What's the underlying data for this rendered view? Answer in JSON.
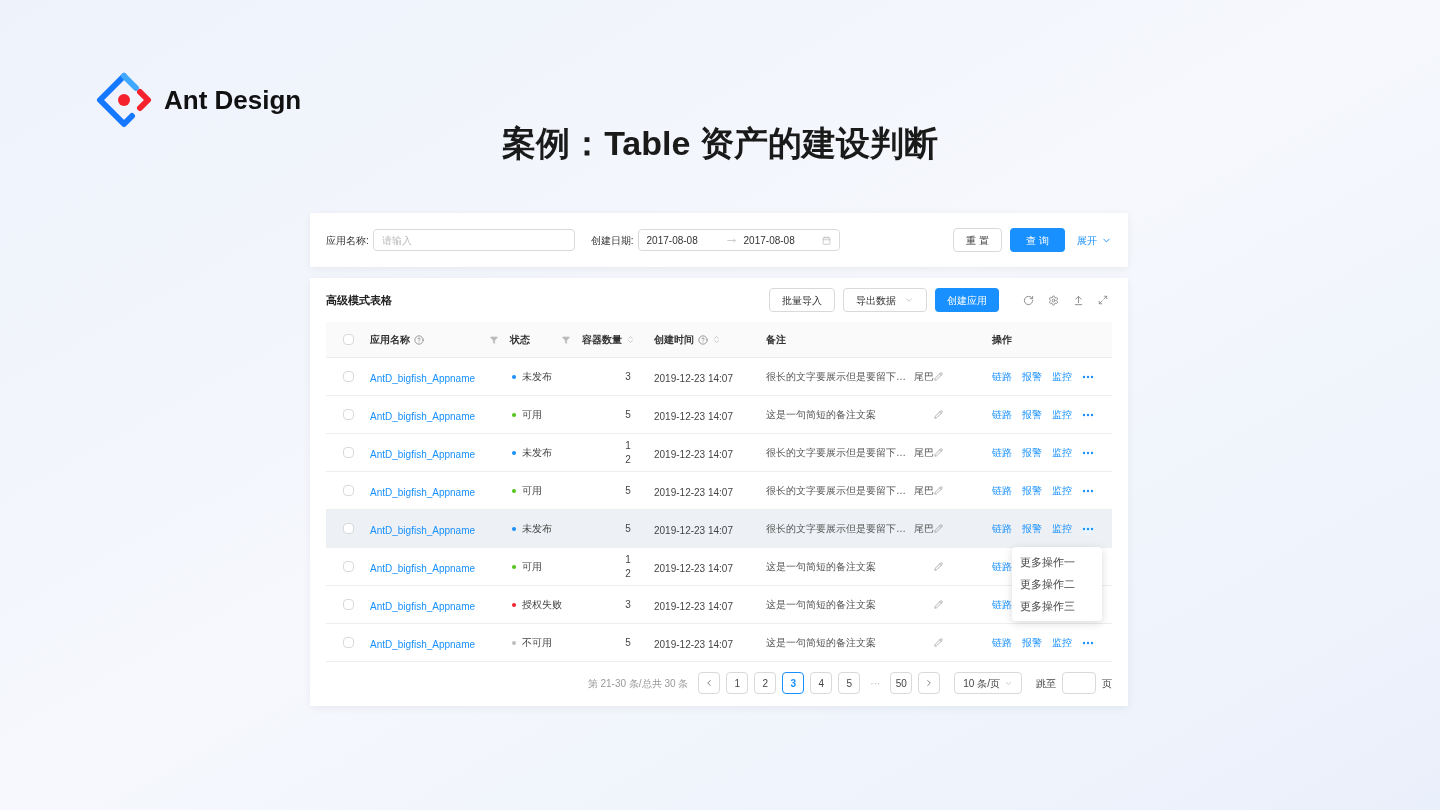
{
  "brand": {
    "name": "Ant Design"
  },
  "slide_title": "案例：Table 资产的建设判断",
  "filter_bar": {
    "fields": [
      {
        "kind": "text",
        "label": "应用名称:",
        "placeholder": "请输入"
      },
      {
        "kind": "daterange",
        "label": "创建日期:",
        "start": "2017-08-08",
        "end": "2017-08-08"
      }
    ],
    "reset": "重 置",
    "search": "查 询",
    "expand": "展开"
  },
  "table_card": {
    "title": "高级模式表格",
    "select_all_checked": false,
    "buttons": [
      {
        "kind": "default",
        "label": "批量导入"
      },
      {
        "kind": "dropdown",
        "label": "导出数据"
      },
      {
        "kind": "primary",
        "label": "创建应用"
      }
    ],
    "columns": [
      {
        "label": "应用名称",
        "help": true,
        "filter": true,
        "sort": false
      },
      {
        "label": "状态",
        "help": false,
        "filter": true,
        "sort": false
      },
      {
        "label": "容器数量",
        "help": false,
        "filter": false,
        "sort": true
      },
      {
        "label": "创建时间",
        "help": true,
        "filter": false,
        "sort": true
      },
      {
        "label": "备注",
        "help": false,
        "filter": false,
        "sort": false
      },
      {
        "label": "操作",
        "help": false,
        "filter": false,
        "sort": false
      }
    ],
    "rows": [
      {
        "checked": false,
        "highlighted": false,
        "menu_open": false,
        "name": "AntD_bigfish_Appname",
        "status": "未发布",
        "color": "#1890ff",
        "count": "3",
        "time": "2019-12-23 14:07",
        "note": "很长的文字要展示但是要留下…",
        "note_tail": "尾巴",
        "actions": [
          "链路",
          "报警",
          "监控"
        ]
      },
      {
        "checked": false,
        "highlighted": false,
        "menu_open": false,
        "name": "AntD_bigfish_Appname",
        "status": "可用",
        "color": "#52c41a",
        "count": "5",
        "time": "2019-12-23 14:07",
        "note": "这是一句简短的备注文案",
        "actions": [
          "链路",
          "报警",
          "监控"
        ]
      },
      {
        "checked": false,
        "highlighted": false,
        "menu_open": false,
        "name": "AntD_bigfish_Appname",
        "status": "未发布",
        "color": "#1890ff",
        "count": "12",
        "time": "2019-12-23 14:07",
        "note": "很长的文字要展示但是要留下…",
        "note_tail": "尾巴",
        "actions": [
          "链路",
          "报警",
          "监控"
        ]
      },
      {
        "checked": false,
        "highlighted": false,
        "menu_open": false,
        "name": "AntD_bigfish_Appname",
        "status": "可用",
        "color": "#52c41a",
        "count": "5",
        "time": "2019-12-23 14:07",
        "note": "很长的文字要展示但是要留下…",
        "note_tail": "尾巴",
        "actions": [
          "链路",
          "报警",
          "监控"
        ]
      },
      {
        "checked": false,
        "highlighted": true,
        "menu_open": true,
        "name": "AntD_bigfish_Appname",
        "status": "未发布",
        "color": "#1890ff",
        "count": "5",
        "time": "2019-12-23 14:07",
        "note": "很长的文字要展示但是要留下…",
        "note_tail": "尾巴",
        "actions": [
          "链路",
          "报警",
          "监控"
        ]
      },
      {
        "checked": false,
        "highlighted": false,
        "menu_open": false,
        "name": "AntD_bigfish_Appname",
        "status": "可用",
        "color": "#52c41a",
        "count": "12",
        "time": "2019-12-23 14:07",
        "note": "这是一句简短的备注文案",
        "actions": [
          "链路"
        ]
      },
      {
        "checked": false,
        "highlighted": false,
        "menu_open": false,
        "name": "AntD_bigfish_Appname",
        "status": "授权失败",
        "color": "#f5222d",
        "count": "3",
        "time": "2019-12-23 14:07",
        "note": "这是一句简短的备注文案",
        "actions": [
          "链路"
        ]
      },
      {
        "checked": false,
        "highlighted": false,
        "menu_open": false,
        "name": "AntD_bigfish_Appname",
        "status": "不可用",
        "color": "#bfbfbf",
        "count": "5",
        "time": "2019-12-23 14:07",
        "note": "这是一句简短的备注文案",
        "actions": [
          "链路",
          "报警",
          "监控"
        ]
      }
    ],
    "more_menu": [
      "更多操作一",
      "更多操作二",
      "更多操作三"
    ],
    "pagination": {
      "summary": "第 21-30 条/总共 30 条",
      "pages": [
        {
          "kind": "page",
          "label": "1",
          "selected": false
        },
        {
          "kind": "page",
          "label": "2",
          "selected": false
        },
        {
          "kind": "page",
          "label": "3",
          "selected": true
        },
        {
          "kind": "page",
          "label": "4",
          "selected": false
        },
        {
          "kind": "page",
          "label": "5",
          "selected": false
        },
        {
          "kind": "ellipsis",
          "label": "···",
          "selected": false
        },
        {
          "kind": "page",
          "label": "50",
          "selected": false
        }
      ],
      "page_size": "10 条/页",
      "jump_label": "跳至",
      "jump_suffix": "页"
    }
  }
}
